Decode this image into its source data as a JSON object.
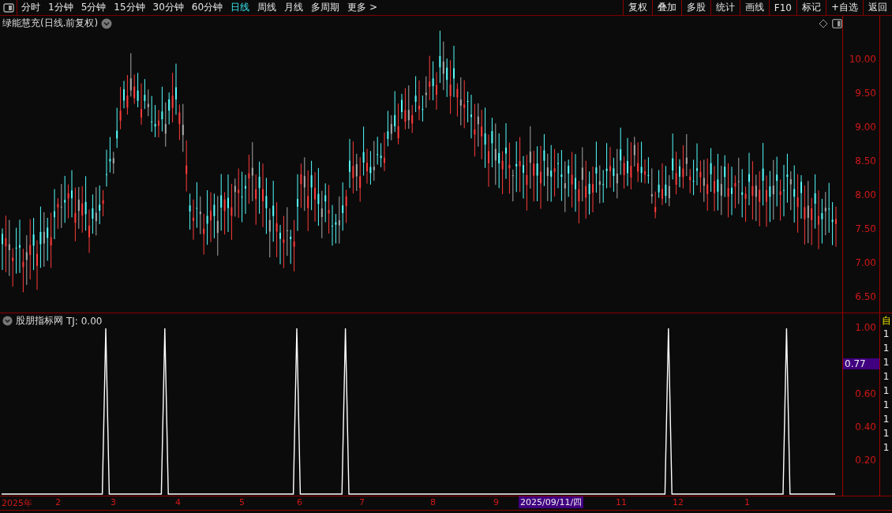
{
  "toolbar": {
    "periods": [
      {
        "label": "分时",
        "selected": false
      },
      {
        "label": "1分钟",
        "selected": false
      },
      {
        "label": "5分钟",
        "selected": false
      },
      {
        "label": "15分钟",
        "selected": false
      },
      {
        "label": "30分钟",
        "selected": false
      },
      {
        "label": "60分钟",
        "selected": false
      },
      {
        "label": "日线",
        "selected": true
      },
      {
        "label": "周线",
        "selected": false
      },
      {
        "label": "月线",
        "selected": false
      },
      {
        "label": "多周期",
        "selected": false
      },
      {
        "label": "更多 >",
        "selected": false
      }
    ],
    "actions": [
      "复权",
      "叠加",
      "多股",
      "统计",
      "画线",
      "F10",
      "标记",
      "+自选",
      "返回"
    ]
  },
  "main_chart": {
    "title": "绿能慧充(日线.前复权)",
    "price_ticks": [
      "10.00",
      "9.50",
      "9.00",
      "8.50",
      "8.00",
      "7.50",
      "7.00",
      "6.50"
    ]
  },
  "indicator": {
    "name": "股朋指标网",
    "reading": "TJ: 0.00",
    "current_value": "0.77",
    "tick_labels": [
      "1.00",
      "0.60",
      "0.40",
      "0.20"
    ]
  },
  "time_axis": {
    "labels": [
      "2025年",
      "2",
      "3",
      "4",
      "5",
      "6",
      "7",
      "8",
      "9",
      "11",
      "12",
      "1"
    ],
    "cursor_date": "2025/09/11/四"
  },
  "side_strip": {
    "header": "自",
    "rows": [
      "1",
      "1",
      "1",
      "1",
      "1",
      "1",
      "1",
      "1",
      "1"
    ]
  }
}
